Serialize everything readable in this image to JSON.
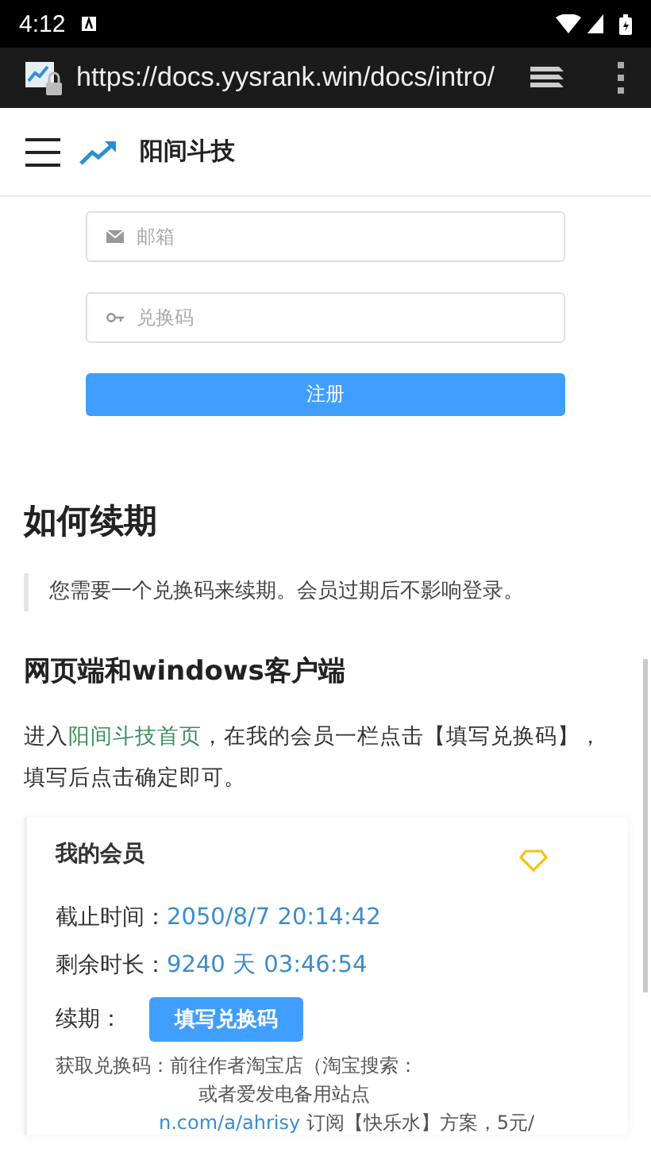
{
  "status_bar": {
    "time": "4:12"
  },
  "browser": {
    "url": "https://docs.yysrank.win/docs/intro/"
  },
  "header": {
    "title": "阳间斗技"
  },
  "form": {
    "fields": [
      {
        "kind": "email",
        "placeholder": "邮箱"
      },
      {
        "kind": "key",
        "placeholder": "兑换码"
      }
    ],
    "submit": "注册"
  },
  "content": {
    "heading": "如何续期",
    "note": "您需要一个兑换码来续期。会员过期后不影响登录。",
    "subheading": "网页端和windows客户端",
    "paragraph": [
      {
        "kind": "text",
        "text": "进入"
      },
      {
        "kind": "link",
        "text": "阳间斗技首页"
      },
      {
        "kind": "text",
        "text": "，在我的会员一栏点击【填写兑换码】，填写后点击确定即可。"
      }
    ]
  },
  "membership": {
    "title": "我的会员",
    "rows": [
      {
        "label": "截止时间：",
        "value": "2050/8/7 20:14:42"
      },
      {
        "label": "剩余时长：",
        "value": "9240 天 03:46:54"
      }
    ],
    "renew": {
      "label": "续期：",
      "button": "填写兑换码"
    },
    "footnote": [
      {
        "kind": "text",
        "text": "获取兑换码：前往作者淘宝店（淘宝搜索："
      },
      {
        "kind": "text",
        "text": "或者爱发电备用站点"
      },
      {
        "kind": "link",
        "text": "n.com/a/ahrisy",
        "after": " 订阅【快乐水】方案，5元/"
      }
    ]
  }
}
